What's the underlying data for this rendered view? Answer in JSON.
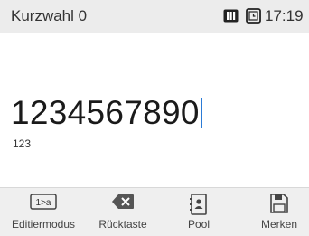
{
  "status": {
    "title": "Kurzwahl 0",
    "time": "17:19",
    "icons": [
      "sim-icon",
      "clock-icon"
    ]
  },
  "input": {
    "number": "1234567890",
    "mode": "123"
  },
  "toolbar": {
    "edit_label": "Editiermodus",
    "edit_icon_text": "1>a",
    "backspace_label": "Rücktaste",
    "pool_label": "Pool",
    "save_label": "Merken"
  },
  "colors": {
    "cursor": "#2b7bd6",
    "bar_background": "#ececec"
  }
}
